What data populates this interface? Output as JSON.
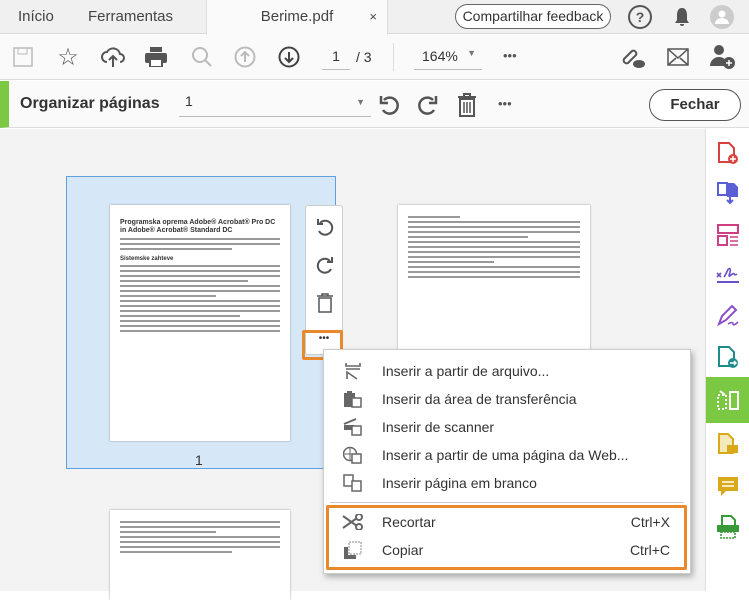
{
  "tabs": {
    "home": "Início",
    "tools": "Ferramentas",
    "document": "Berime.pdf",
    "close": "×"
  },
  "header": {
    "feedback": "Compartilhar feedback",
    "help": "?"
  },
  "toolbar": {
    "page_current": "1",
    "page_total": "/ 3",
    "zoom": "164%",
    "more": "•••"
  },
  "organize": {
    "title": "Organizar páginas",
    "page_range": "1",
    "more": "•••",
    "close": "Fechar"
  },
  "thumbnails": [
    {
      "label": "1",
      "title": "Programska oprema Adobe® Acrobat® Pro DC in Adobe® Acrobat® Standard DC",
      "heading": "Sistemske zahteve"
    }
  ],
  "page_tools_more": "•••",
  "context_menu": {
    "items": [
      {
        "label": "Inserir a partir de arquivo...",
        "icon": "insert-file-icon"
      },
      {
        "label": "Inserir da área de transferência",
        "icon": "clipboard-icon"
      },
      {
        "label": "Inserir de scanner",
        "icon": "scanner-icon"
      },
      {
        "label": "Inserir a partir de uma página da Web...",
        "icon": "web-page-icon"
      },
      {
        "label": "Inserir página em branco",
        "icon": "blank-page-icon"
      },
      {
        "label": "Recortar",
        "shortcut": "Ctrl+X",
        "icon": "scissors-icon"
      },
      {
        "label": "Copiar",
        "shortcut": "Ctrl+C",
        "icon": "copy-icon"
      }
    ]
  },
  "colors": {
    "accent": "#7bc843",
    "highlight": "#e8892b"
  }
}
